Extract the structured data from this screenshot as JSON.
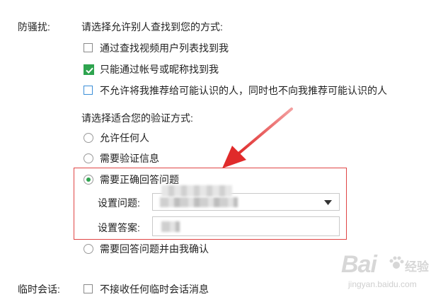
{
  "anti_harass": {
    "label": "防骚扰:",
    "find_prompt": "请选择允许别人查找到您的方式:",
    "find_options": [
      {
        "label": "通过查找视频用户列表找到我",
        "checked": false
      },
      {
        "label": "只能通过帐号或昵称找到我",
        "checked": true
      },
      {
        "label": "不允许将我推荐给可能认识的人，同时也不向我推荐可能认识的人",
        "checked": false
      }
    ],
    "verify_prompt": "请选择适合您的验证方式:",
    "verify_options": [
      {
        "label": "允许任何人",
        "selected": false
      },
      {
        "label": "需要验证信息",
        "selected": false
      },
      {
        "label": "需要正确回答问题",
        "selected": true
      },
      {
        "label": "需要回答问题并由我确认",
        "selected": false
      }
    ],
    "question_label": "设置问题:",
    "answer_label": "设置答案:"
  },
  "temp_chat": {
    "label": "临时会话:",
    "option": {
      "label": "不接收任何临时会话消息",
      "checked": false
    }
  },
  "watermark": {
    "text": "Bai",
    "logo_text": "经验",
    "url": "jingyan.baidu.com"
  },
  "colors": {
    "accent_green": "#2ea44f",
    "annotation_red": "#e04545",
    "checkbox_blue": "#3b8fd8"
  },
  "icons": {
    "dropdown": "triangle-down-icon",
    "check": "checkmark-icon"
  }
}
